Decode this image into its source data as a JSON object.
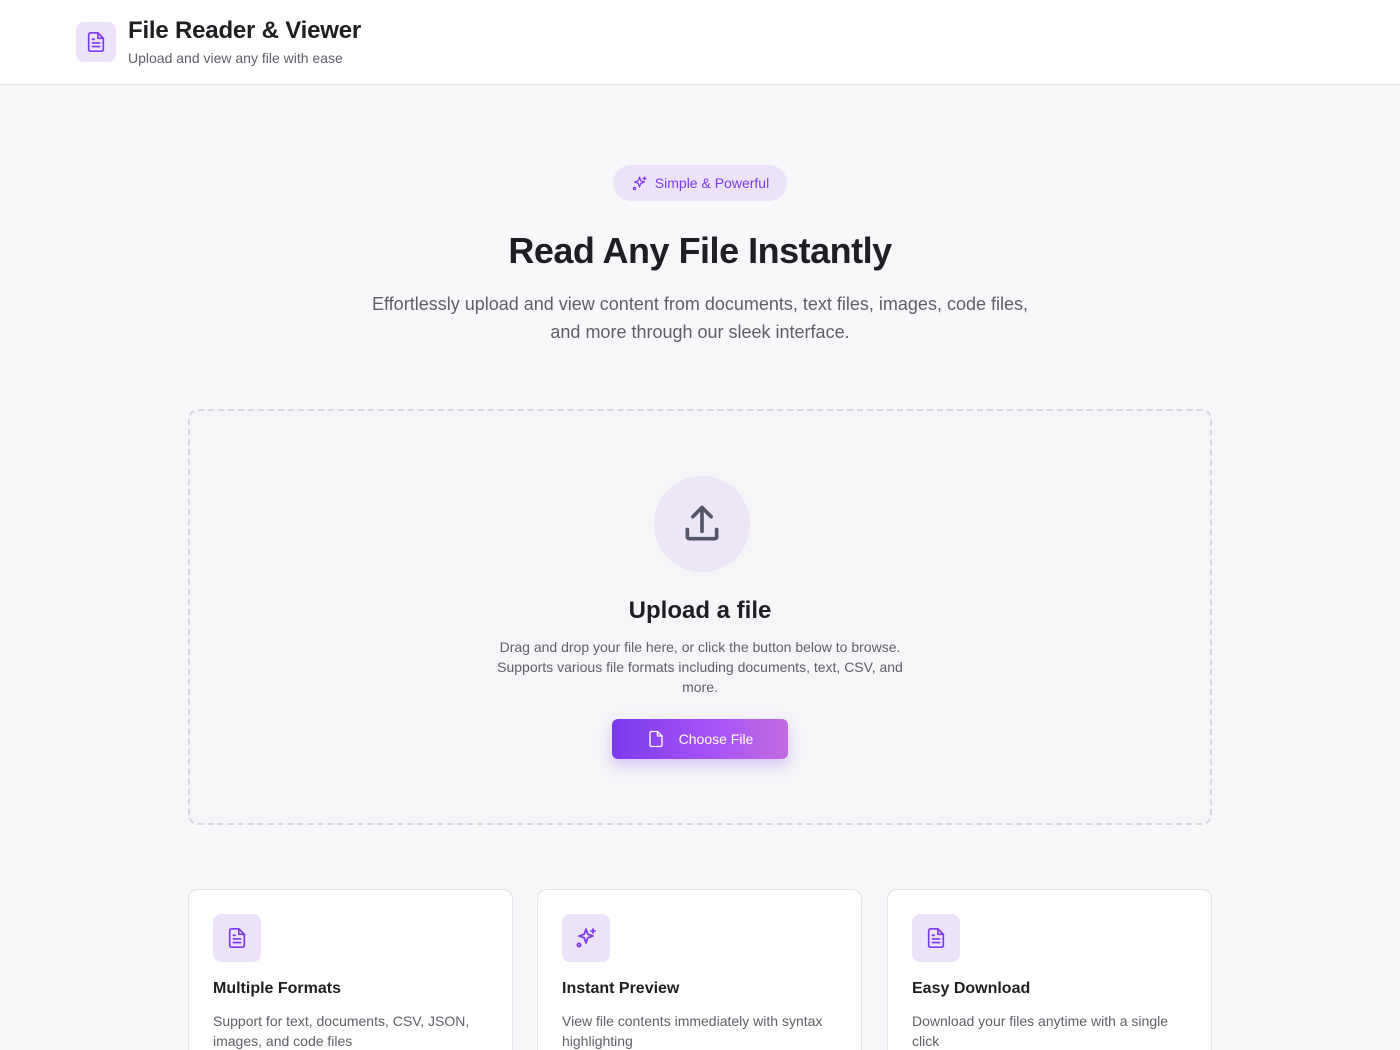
{
  "header": {
    "icon": "document-icon",
    "title": "File Reader & Viewer",
    "subtitle": "Upload and view any file with ease"
  },
  "hero": {
    "badge_icon": "sparkles-icon",
    "badge_label": "Simple & Powerful",
    "title": "Read Any File Instantly",
    "description": "Effortlessly upload and view content from documents, text files, images, code files, and more through our sleek interface."
  },
  "upload": {
    "icon": "upload-icon",
    "title": "Upload a file",
    "description": "Drag and drop your file here, or click the button below to browse. Supports various file formats including documents, text, CSV, and more.",
    "button_icon": "file-icon",
    "button_label": "Choose File"
  },
  "features": [
    {
      "icon": "document-icon",
      "title": "Multiple Formats",
      "description": "Support for text, documents, CSV, JSON, images, and code files"
    },
    {
      "icon": "sparkles-icon",
      "title": "Instant Preview",
      "description": "View file contents immediately with syntax highlighting"
    },
    {
      "icon": "document-icon",
      "title": "Easy Download",
      "description": "Download your files anytime with a single click"
    }
  ],
  "colors": {
    "accent": "#7c3aed",
    "accent_light": "#ece3fb",
    "gradient_end": "#c06ae0",
    "text": "#1f1f23",
    "muted": "#5f5f68"
  }
}
